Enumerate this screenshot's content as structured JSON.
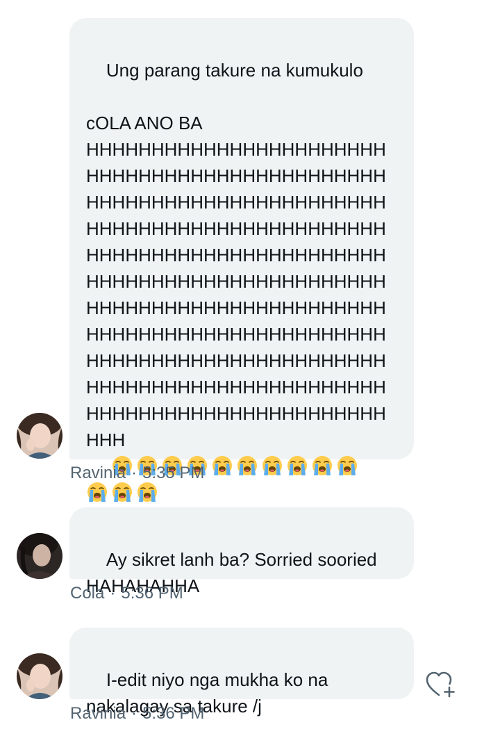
{
  "messages": [
    {
      "sender": "Ravinia",
      "time": "5:35 PM",
      "text": "Ung parang takure na kumukulo\n\ncOLA ANO BA\nHHHHHHHHHHHHHHHHHHHHHHH\nHHHHHHHHHHHHHHHHHHHHHHH\nHHHHHHHHHHHHHHHHHHHHHHH\nHHHHHHHHHHHHHHHHHHHHHHH\nHHHHHHHHHHHHHHHHHHHHHHH\nHHHHHHHHHHHHHHHHHHHHHHH\nHHHHHHHHHHHHHHHHHHHHHHH\nHHHHHHHHHHHHHHHHHHHHHHH\nHHHHHHHHHHHHHHHHHHHHHHH\nHHHHHHHHHHHHHHHHHHHHHHH\nHHHHHHHHHHHHHHHHHHHHHHH\nHHH",
      "emoji": "loudly-crying-face",
      "emoji_count": 13
    },
    {
      "sender": "Cola",
      "time": "5:36 PM",
      "text": "Ay sikret lanh ba? Sorried sooried\nHAHAHAHHA"
    },
    {
      "sender": "Ravinia",
      "time": "5:36 PM",
      "text": "I-edit niyo nga mukha ko na\nnakalagay sa takure /j"
    }
  ],
  "meta_separator": "·",
  "colors": {
    "bubble_bg": "#eff3f4",
    "text": "#0f1419",
    "meta": "#536471",
    "reaction_icon": "#536471"
  },
  "icons": {
    "reaction": "heart-plus-icon"
  }
}
